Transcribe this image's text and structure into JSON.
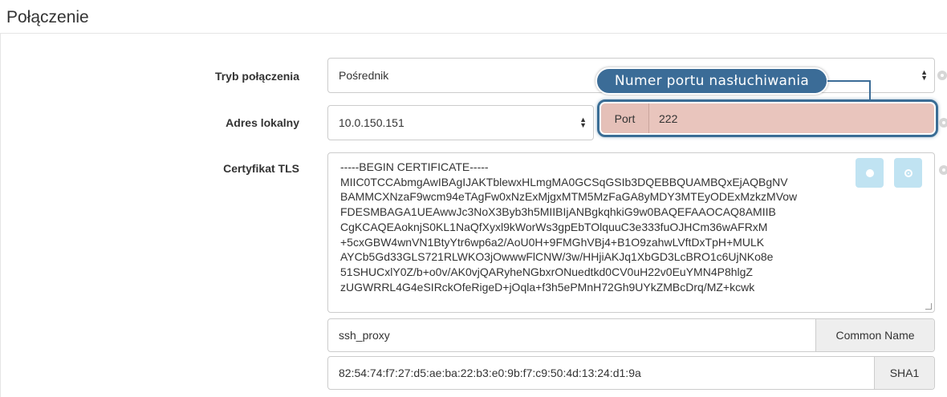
{
  "section": {
    "title": "Połączenie"
  },
  "connection_mode": {
    "label": "Tryb połączenia",
    "value": "Pośrednik"
  },
  "local_address": {
    "label": "Adres lokalny",
    "value": "10.0.150.151",
    "port_label": "Port",
    "port_value": "222"
  },
  "tooltip": {
    "text": "Numer portu nasłuchiwania"
  },
  "tls_certificate": {
    "label": "Certyfikat TLS",
    "lines": [
      "-----BEGIN CERTIFICATE-----",
      "MIIC0TCCAbmgAwIBAgIJAKTblewxHLmgMA0GCSqGSIb3DQEBBQUAMBQxEjAQBgNV",
      "BAMMCXNzaF9wcm94eTAgFw0xNzExMjgxMTM5MzFaGA8yMDY3MTEyODExMzkzMVow",
      "FDESMBAGA1UEAwwJc3NoX3Byb3h5MIIBIjANBgkqhkiG9w0BAQEFAAOCAQ8AMIIB",
      "CgKCAQEAoknjS0KL1NaQfXyxl9kWorWs3gpEbTOlquuC3e333fuOJHCm36wAFRxM",
      "+5cxGBW4wnVN1BtyYtr6wp6a2/AoU0H+9FMGhVBj4+B1O9zahwLVftDxTpH+MULK",
      "AYCb5Gd33GLS721RLWKO3jOwwwFlCNW/3w/HHjiAKJq1XbGD3LcBRO1c6UjNKo8e",
      "51SHUCxlY0Z/b+o0v/AK0vjQARyheNGbxrONuedtkd0CV0uH22v0EuYMN4P8hlgZ",
      "zUGWRRL4G4eSIRckOfeRigeD+jOqla+f3h5ePMnH72Gh9UYkZMBcDrq/MZ+kcwk"
    ],
    "common_name_value": "ssh_proxy",
    "common_name_label": "Common Name",
    "sha1_value": "82:54:74:f7:27:d5:ae:ba:22:b3:e0:9b:f7:c9:50:4d:13:24:d1:9a",
    "sha1_label": "SHA1"
  },
  "icons": {
    "select_arrows": "up-down-arrows-icon",
    "gear": "gear-icon",
    "upload": "upload-icon",
    "settings": "settings-icon"
  },
  "colors": {
    "tooltip_bg": "#3b6c97",
    "highlight_border": "#3a6d95",
    "port_bg": "#e9c5bd",
    "cert_button_bg": "#c0e3f2"
  }
}
